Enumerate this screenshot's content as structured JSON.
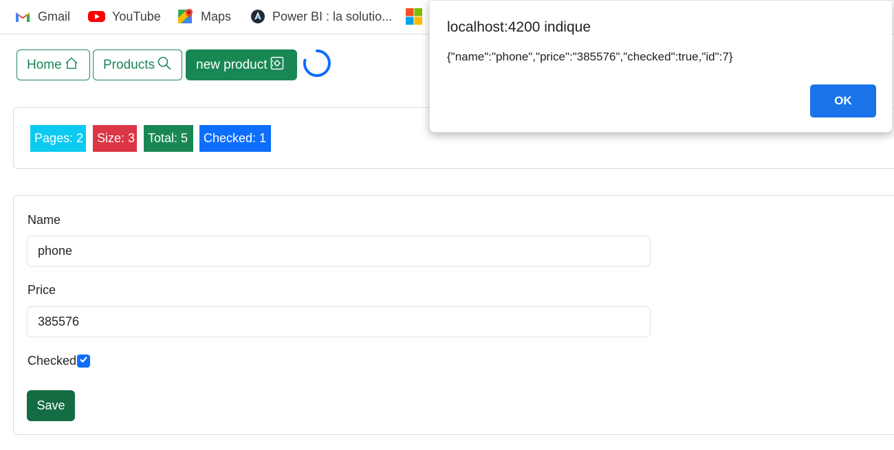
{
  "bookmarks": [
    {
      "label": "Gmail",
      "icon": "gmail-icon"
    },
    {
      "label": "YouTube",
      "icon": "youtube-icon"
    },
    {
      "label": "Maps",
      "icon": "maps-icon"
    },
    {
      "label": "Power BI : la solutio...",
      "icon": "powerbi-icon"
    },
    {
      "label": "",
      "icon": "microsoft-icon"
    }
  ],
  "nav": {
    "home_label": "Home",
    "products_label": "Products",
    "new_product_label": "new product"
  },
  "stats": {
    "pages": "Pages: 2",
    "size": "Size: 3",
    "total": "Total: 5",
    "checked": "Checked: 1"
  },
  "form": {
    "name_label": "Name",
    "name_value": "phone",
    "price_label": "Price",
    "price_value": "385576",
    "checked_label": "Checked",
    "checked_value": true,
    "save_label": "Save"
  },
  "dialog": {
    "title": "localhost:4200 indique",
    "message": "{\"name\":\"phone\",\"price\":\"385576\",\"checked\":true,\"id\":7}",
    "ok_label": "OK"
  },
  "colors": {
    "success": "#198754",
    "info": "#0dcaf0",
    "danger": "#dc3545",
    "primary": "#0d6efd",
    "dialog_button": "#1a73e8"
  }
}
